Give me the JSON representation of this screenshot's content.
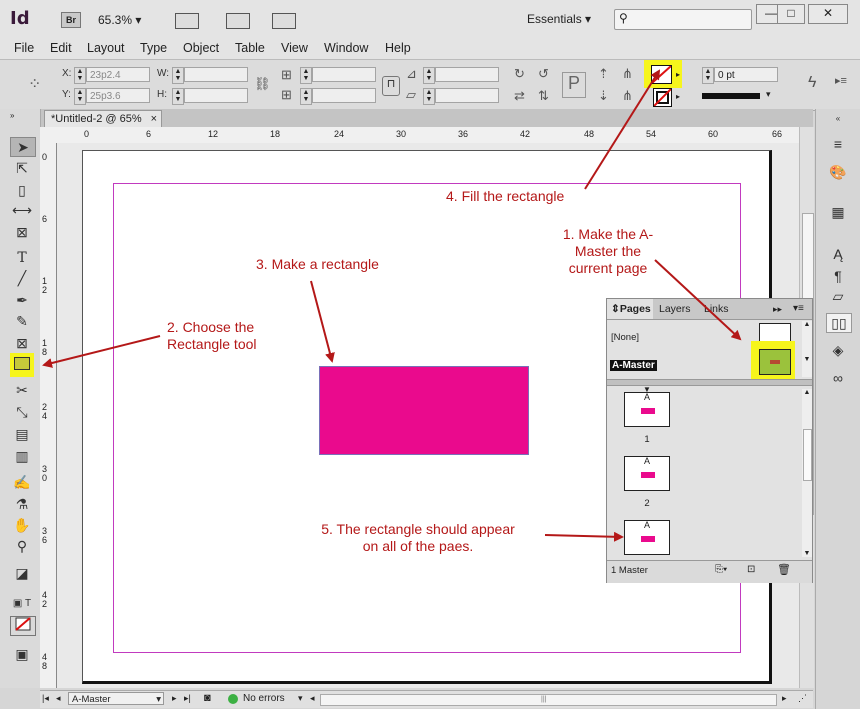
{
  "app": {
    "logo": "Id",
    "bridge": "Br",
    "zoom": "65.3%",
    "workspace": "Essentials"
  },
  "window_controls": {
    "minimize": "—",
    "maximize": "□",
    "close": "✕"
  },
  "menu": [
    "File",
    "Edit",
    "Layout",
    "Type",
    "Object",
    "Table",
    "View",
    "Window",
    "Help"
  ],
  "control_panel": {
    "x_label": "X:",
    "x_value": "23p2.4",
    "y_label": "Y:",
    "y_value": "25p3.6",
    "w_label": "W:",
    "h_label": "H:",
    "stroke_weight": "0 pt"
  },
  "document_tab": {
    "title": "*Untitled-2 @ 65%",
    "close": "×"
  },
  "ruler": {
    "horizontal": [
      "0",
      "6",
      "12",
      "18",
      "24",
      "30",
      "36",
      "42",
      "48",
      "54",
      "60",
      "66"
    ],
    "vertical": [
      "0",
      "6",
      "1\n2",
      "1\n8",
      "2\n4",
      "3\n0",
      "3\n6",
      "4\n2",
      "4\n8"
    ]
  },
  "pages_panel": {
    "tabs": [
      "Pages",
      "Layers",
      "Links"
    ],
    "none_label": "[None]",
    "master_label": "A-Master",
    "pages": [
      {
        "master": "A",
        "number": "1"
      },
      {
        "master": "A",
        "number": "2"
      },
      {
        "master": "A",
        "number": ""
      }
    ],
    "footer": "1 Master"
  },
  "status_bar": {
    "page": "A-Master",
    "errors": "No errors"
  },
  "annotations": {
    "step1": "1. Make the A-\nMaster the\ncurrent page",
    "step2": "2. Choose the\nRectangle tool",
    "step3": "3. Make a rectangle",
    "step4": "4. Fill the rectangle",
    "step5": "5. The rectangle should appear\non all of the paes."
  },
  "colors": {
    "rectangle_fill": "#ea0a8d",
    "margin_guide": "#c13abf",
    "annotation": "#b41818",
    "highlight": "#f6f51c",
    "master_thumb": "#9bc23c"
  }
}
